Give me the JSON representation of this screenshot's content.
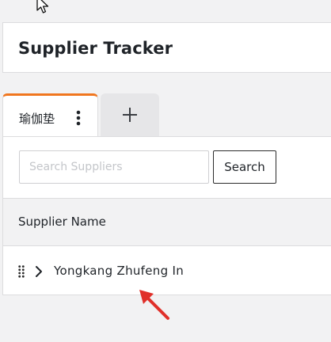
{
  "page": {
    "title": "Supplier Tracker"
  },
  "tabs": [
    {
      "label": "瑜伽垫",
      "active": true,
      "menu_icon": "kebab-menu-icon"
    },
    {
      "label": "",
      "icon": "plus-icon"
    }
  ],
  "search": {
    "placeholder": "Search Suppliers",
    "value": "",
    "button_label": "Search"
  },
  "table": {
    "columns": [
      "Supplier Name"
    ],
    "rows": [
      {
        "name": "Yongkang Zhufeng In",
        "expanded": false
      }
    ]
  },
  "colors": {
    "accent_tab": "#f0761e",
    "annotation_arrow": "#e0302a",
    "header_bg": "#f2f2f3"
  },
  "icons": {
    "cursor": "mouse-pointer-icon",
    "annotation": "red-arrow-icon",
    "drag": "drag-handle-icon",
    "expand": "chevron-right-icon"
  }
}
